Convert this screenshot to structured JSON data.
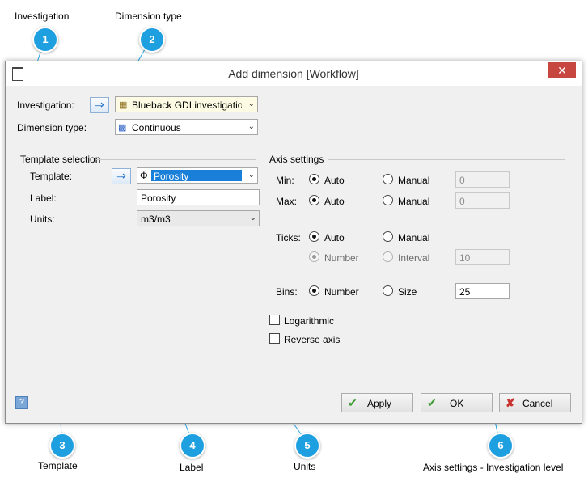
{
  "callouts": [
    {
      "num": "1",
      "label": "Investigation"
    },
    {
      "num": "2",
      "label": "Dimension type"
    },
    {
      "num": "3",
      "label": "Template"
    },
    {
      "num": "4",
      "label": "Label"
    },
    {
      "num": "5",
      "label": "Units"
    },
    {
      "num": "6",
      "label": "Axis settings - Investigation level"
    }
  ],
  "window": {
    "title": "Add dimension  [Workflow]",
    "close_glyph": "✕"
  },
  "investigation": {
    "label": "Investigation:",
    "value": "Blueback GDI investigation ‹"
  },
  "dimension_type": {
    "label": "Dimension type:",
    "value": "Continuous"
  },
  "template_selection": {
    "group_title": "Template selection",
    "template_label": "Template:",
    "template_value": "Porosity",
    "label_label": "Label:",
    "label_value": "Porosity",
    "units_label": "Units:",
    "units_value": "m3/m3"
  },
  "axis_settings": {
    "group_title": "Axis settings",
    "min_label": "Min:",
    "max_label": "Max:",
    "ticks_label": "Ticks:",
    "bins_label": "Bins:",
    "auto": "Auto",
    "manual": "Manual",
    "number": "Number",
    "interval": "Interval",
    "size": "Size",
    "min_value": "0",
    "max_value": "0",
    "ticks_value": "10",
    "bins_value": "25",
    "logarithmic": "Logarithmic",
    "reverse_axis": "Reverse axis"
  },
  "buttons": {
    "apply": "Apply",
    "ok": "OK",
    "cancel": "Cancel",
    "help": "?"
  },
  "colors": {
    "callout": "#1e9fe0",
    "close": "#c7463f",
    "selection": "#1a7fd8"
  }
}
